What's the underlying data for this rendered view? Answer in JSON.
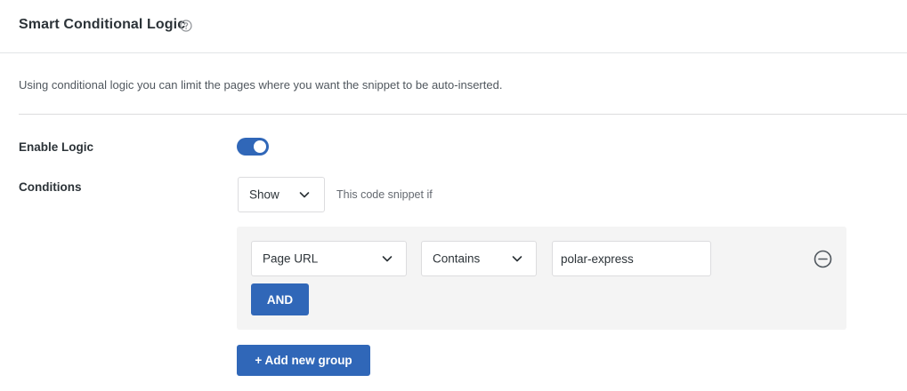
{
  "header": {
    "title": "Smart Conditional Logic",
    "help_icon": "question-circle-icon"
  },
  "description": "Using conditional logic you can limit the pages where you want the snippet to be auto-inserted.",
  "enable_logic": {
    "label": "Enable Logic",
    "enabled": true,
    "accent": "#3067b8"
  },
  "conditions": {
    "label": "Conditions",
    "show_select": {
      "value": "Show"
    },
    "hint": "This code snippet if",
    "groups": [
      {
        "rule": {
          "field": "Page URL",
          "operator": "Contains",
          "value": "polar-express"
        },
        "and_label": "AND",
        "remove_icon": "minus-circle-icon"
      }
    ],
    "add_group_label": "+ Add new group"
  }
}
